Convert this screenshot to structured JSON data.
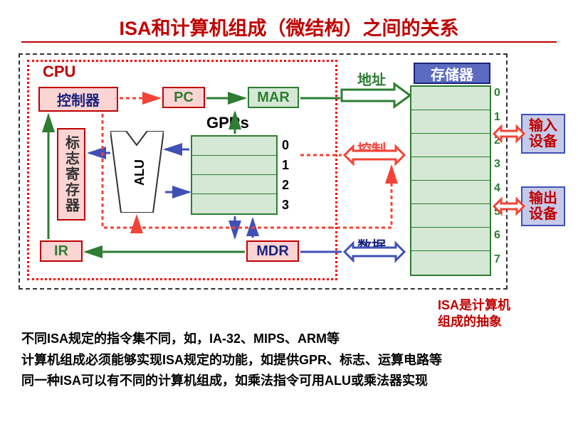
{
  "title": "ISA和计算机组成（微结构）之间的关系",
  "cpu_label": "CPU",
  "blocks": {
    "controller": "控制器",
    "pc": "PC",
    "mar": "MAR",
    "flags": "标志寄存器",
    "alu": "ALU",
    "gprs_label": "GPRs",
    "ir": "IR",
    "mdr": "MDR",
    "memory_label": "存储器",
    "input_l1": "输入",
    "input_l2": "设备",
    "output_l1": "输出",
    "output_l2": "设备"
  },
  "gprs_indices": [
    "0",
    "1",
    "2",
    "3"
  ],
  "mem_indices": [
    "0",
    "1",
    "2",
    "3",
    "4",
    "5",
    "6",
    "7"
  ],
  "bus_labels": {
    "address": "地址",
    "control": "控制",
    "data": "数据"
  },
  "isa_note_l1": "ISA是计算机",
  "isa_note_l2": "组成的抽象",
  "body_text_l1": "不同ISA规定的指令集不同，如，IA-32、MIPS、ARM等",
  "body_text_l2": "计算机组成必须能够实现ISA规定的功能，如提供GPR、标志、运算电路等",
  "body_text_l3": "同一种ISA可以有不同的计算机组成，如乘法指令可用ALU或乘法器实现"
}
